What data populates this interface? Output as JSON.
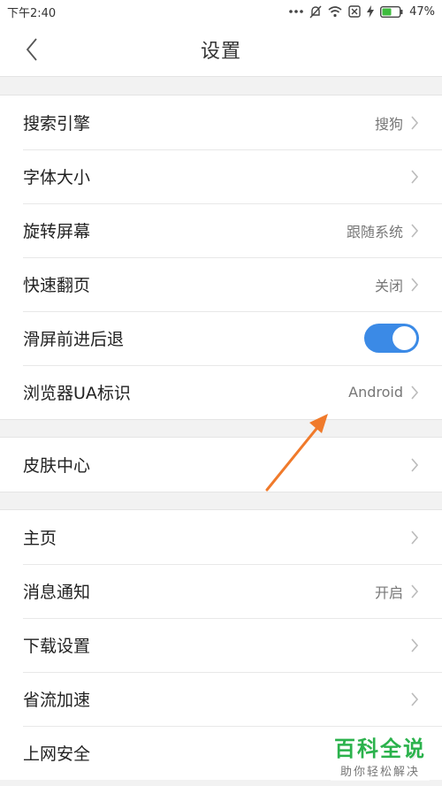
{
  "status_bar": {
    "time": "下午2:40",
    "battery": "47%"
  },
  "header": {
    "title": "设置"
  },
  "groups": [
    {
      "rows": [
        {
          "label": "搜索引擎",
          "value": "搜狗"
        },
        {
          "label": "字体大小",
          "value": ""
        },
        {
          "label": "旋转屏幕",
          "value": "跟随系统"
        },
        {
          "label": "快速翻页",
          "value": "关闭"
        },
        {
          "label": "滑屏前进后退",
          "toggle_on": true
        },
        {
          "label": "浏览器UA标识",
          "value": "Android"
        }
      ]
    },
    {
      "rows": [
        {
          "label": "皮肤中心",
          "value": ""
        }
      ]
    },
    {
      "rows": [
        {
          "label": "主页",
          "value": ""
        },
        {
          "label": "消息通知",
          "value": "开启"
        },
        {
          "label": "下载设置",
          "value": ""
        },
        {
          "label": "省流加速",
          "value": ""
        },
        {
          "label": "上网安全",
          "value": ""
        }
      ]
    }
  ],
  "watermark": {
    "title": "百科全说",
    "subtitle": "助你轻松解决"
  },
  "colors": {
    "toggle_on": "#3b8ae6",
    "annotation_arrow": "#f07a2b",
    "watermark_green": "#2bb24c"
  }
}
